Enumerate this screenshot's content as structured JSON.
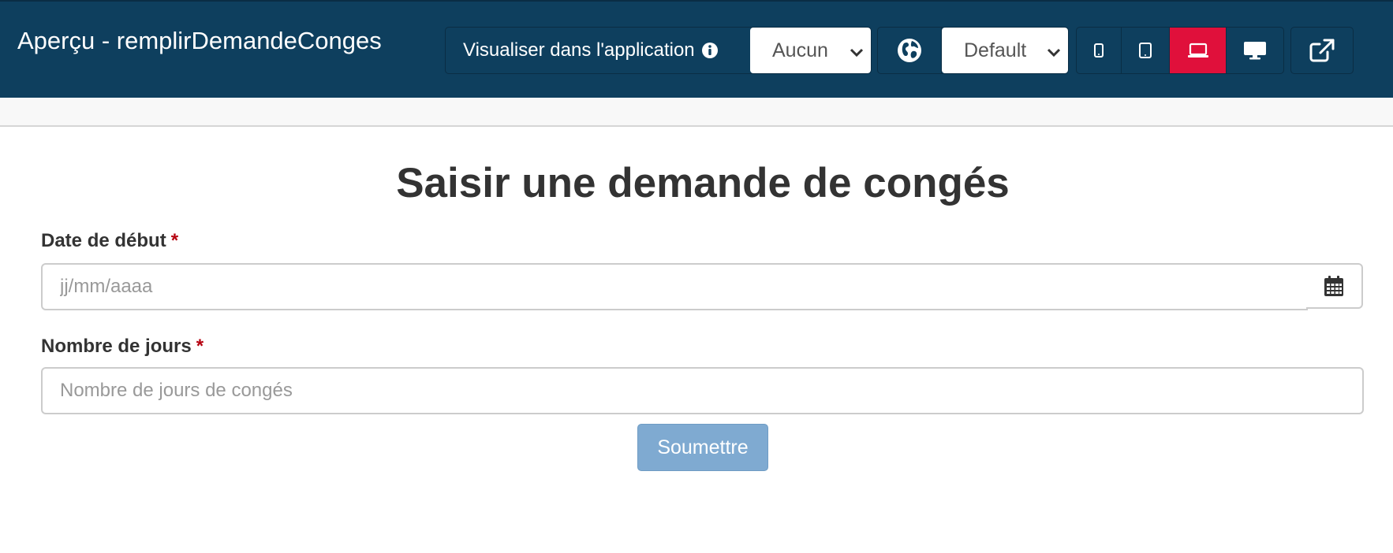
{
  "header": {
    "title": "Aperçu - remplirDemandeConges",
    "app_selector": {
      "label": "Visualiser dans l'application",
      "selected": "Aucun"
    },
    "theme_selector": {
      "selected": "Default"
    },
    "devices": [
      {
        "name": "phone",
        "active": false
      },
      {
        "name": "tablet",
        "active": false
      },
      {
        "name": "laptop",
        "active": true
      },
      {
        "name": "desktop",
        "active": false
      }
    ],
    "colors": {
      "bar_background": "#0e3f5e",
      "active_device": "#e0103b"
    }
  },
  "form": {
    "title": "Saisir une demande de congés",
    "start_date": {
      "label": "Date de début",
      "required_mark": "*",
      "placeholder": "jj/mm/aaaa",
      "value": ""
    },
    "days": {
      "label": "Nombre de jours",
      "required_mark": "*",
      "placeholder": "Nombre de jours de congés",
      "value": ""
    },
    "submit_label": "Soumettre"
  }
}
